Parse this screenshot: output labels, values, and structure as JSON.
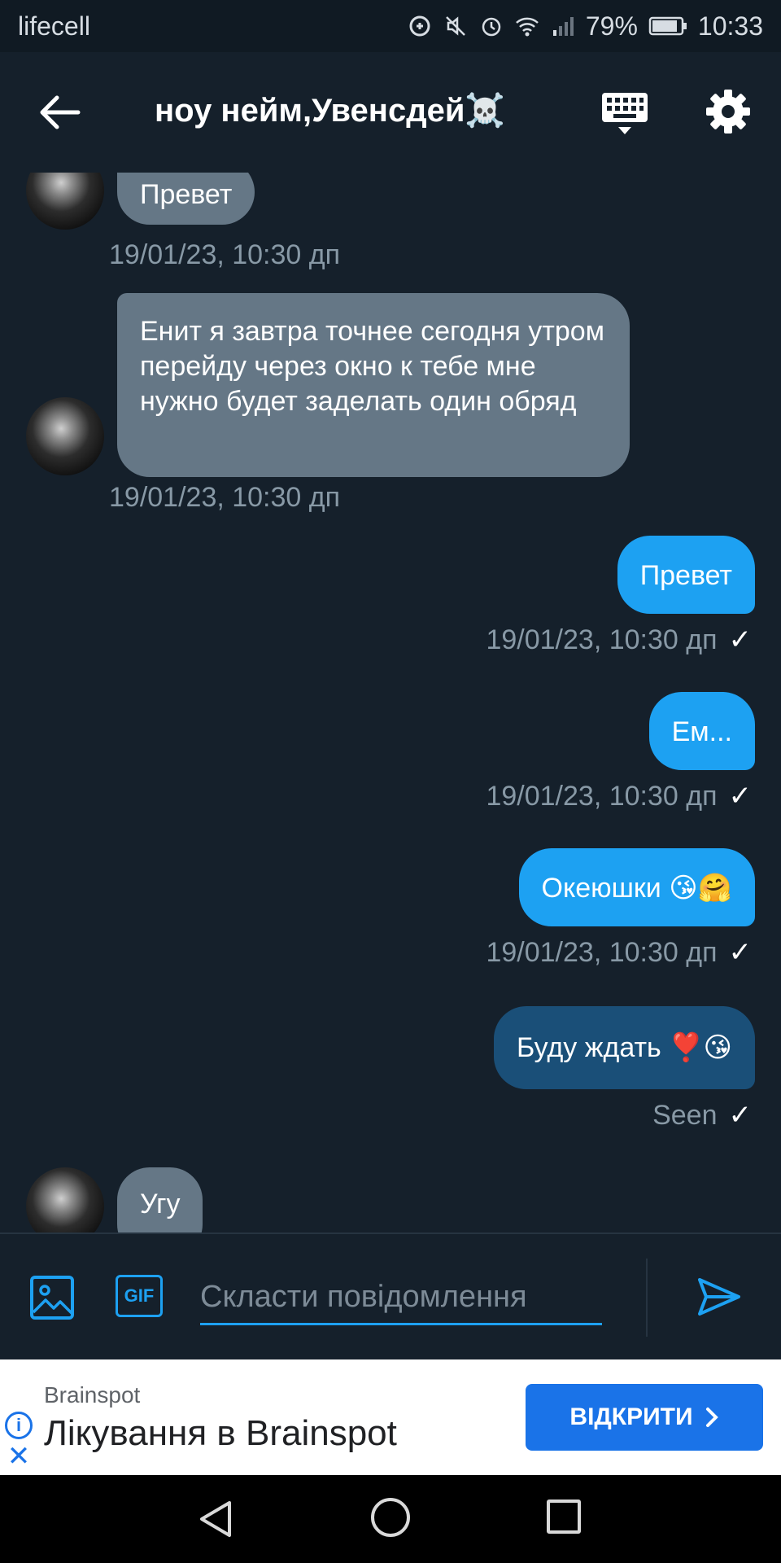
{
  "status_bar": {
    "carrier": "lifecell",
    "battery": "79%",
    "time": "10:33"
  },
  "header": {
    "title": "ноу нейм,Увенсдей☠️"
  },
  "messages": [
    {
      "direction": "in",
      "text": "Превет",
      "meta": "19/01/23, 10:30 дп"
    },
    {
      "direction": "in",
      "text": "Енит я завтра точнее сегодня утром перейду через окно к тебе мне нужно будет заделать один обряд",
      "meta": "19/01/23, 10:30 дп"
    },
    {
      "direction": "out",
      "text": "Превет",
      "meta": "19/01/23, 10:30 дп",
      "check": "✓"
    },
    {
      "direction": "out",
      "text": "Ем...",
      "meta": "19/01/23, 10:30 дп",
      "check": "✓"
    },
    {
      "direction": "out",
      "text": "Океюшки 😘🤗",
      "meta": "19/01/23, 10:30 дп",
      "check": "✓"
    },
    {
      "direction": "out",
      "text": "Буду ждать ❣️😘",
      "meta": "Seen",
      "check": "✓"
    },
    {
      "direction": "in",
      "text": "Угу"
    }
  ],
  "composer": {
    "gif_label": "GIF",
    "placeholder": "Скласти повідомлення"
  },
  "ad": {
    "source": "Brainspot",
    "title": "Лікування в Brainspot",
    "button_label": "ВІДКРИТИ"
  },
  "colors": {
    "background": "#15202b",
    "incoming_bubble": "#657786",
    "outgoing_bubble": "#1da1f2",
    "accent": "#1da1f2",
    "ad_button": "#1a73e8"
  }
}
